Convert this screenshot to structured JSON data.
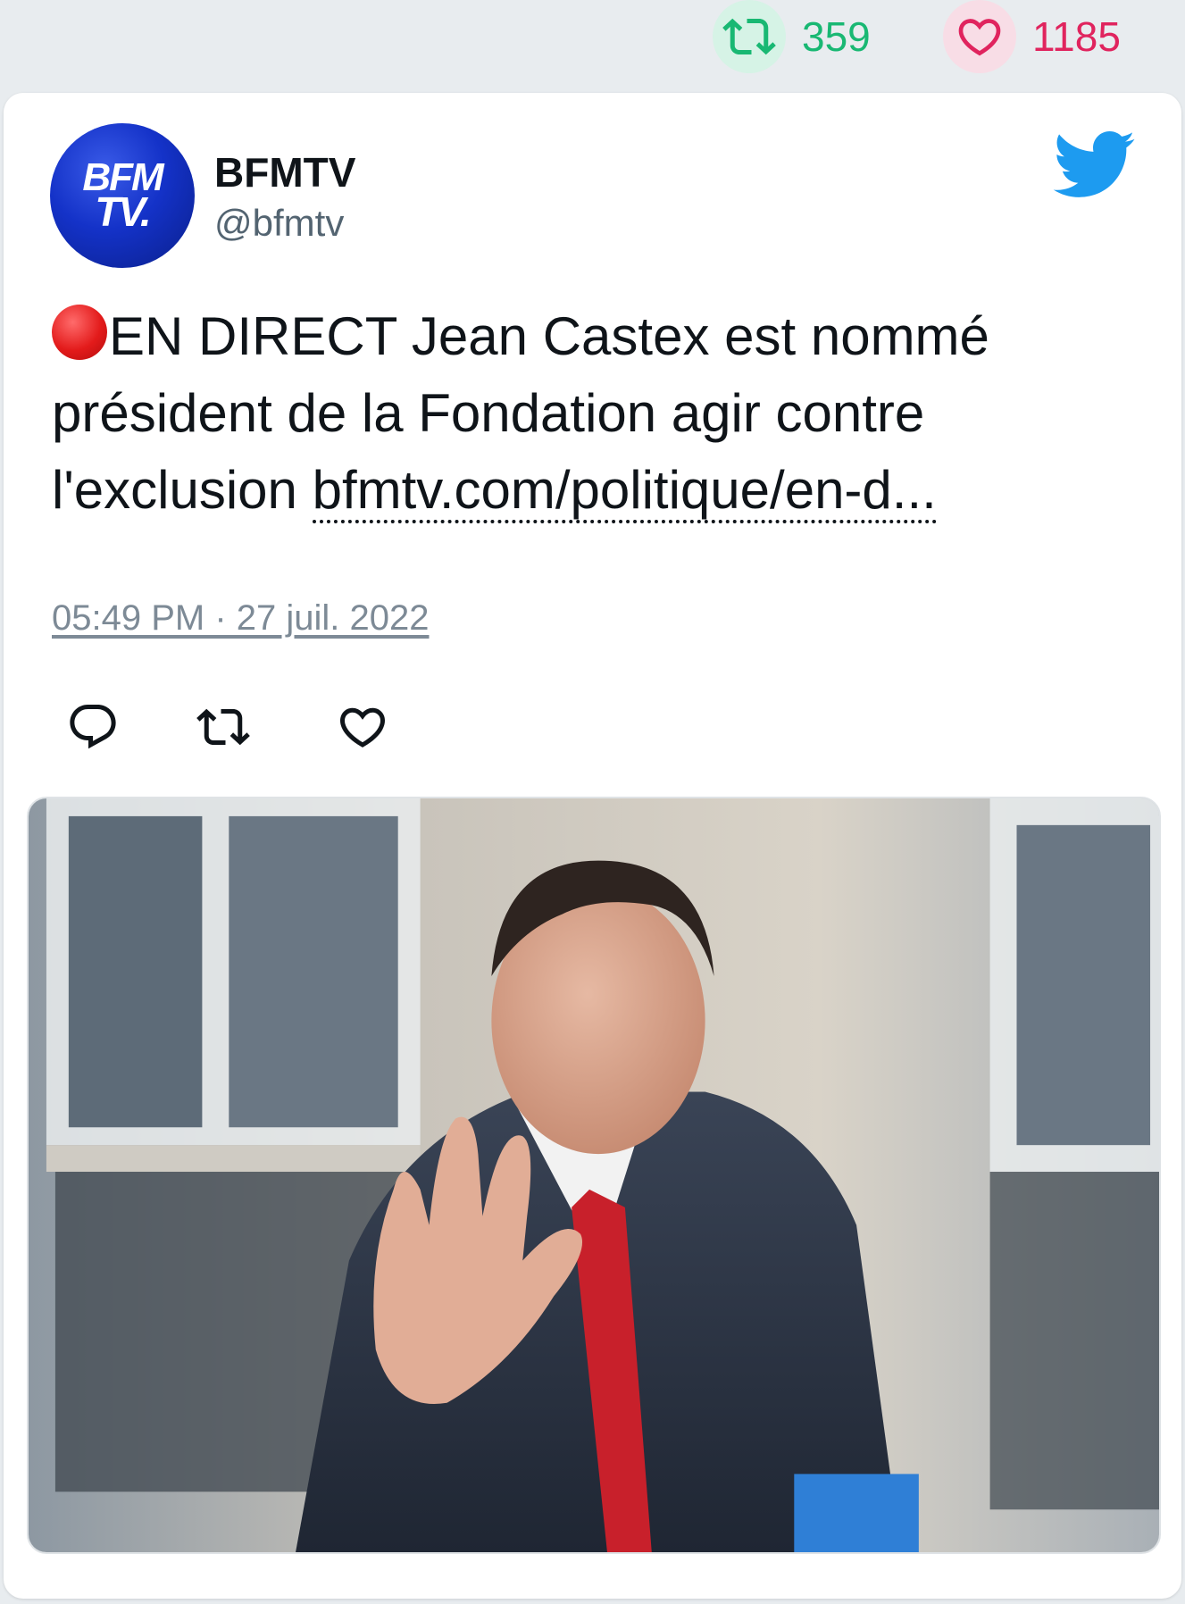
{
  "stats": {
    "retweets": "359",
    "likes": "1185"
  },
  "tweet": {
    "author_name": "BFMTV",
    "author_handle": "@bfmtv",
    "avatar_text_line1": "BFM",
    "avatar_text_line2": "TV.",
    "text": "EN DIRECT Jean Castex est nommé président de la Fondation agir contre l'exclusion",
    "link": "bfmtv.com/politique/en-d...",
    "timestamp": "05:49 PM · 27 juil. 2022"
  },
  "icons": {
    "stat_retweet": "retweet-icon",
    "stat_like": "heart-icon",
    "brand": "twitter-bird-icon",
    "live": "red-circle-icon",
    "reply": "reply-icon",
    "retweet": "retweet-icon",
    "like": "heart-icon"
  },
  "colors": {
    "retweet_green": "#19b873",
    "like_pink": "#e0245e",
    "twitter_blue": "#1d9bf0",
    "text_primary": "#0f1419",
    "text_secondary": "#536471"
  },
  "media": {
    "kind": "photo"
  }
}
